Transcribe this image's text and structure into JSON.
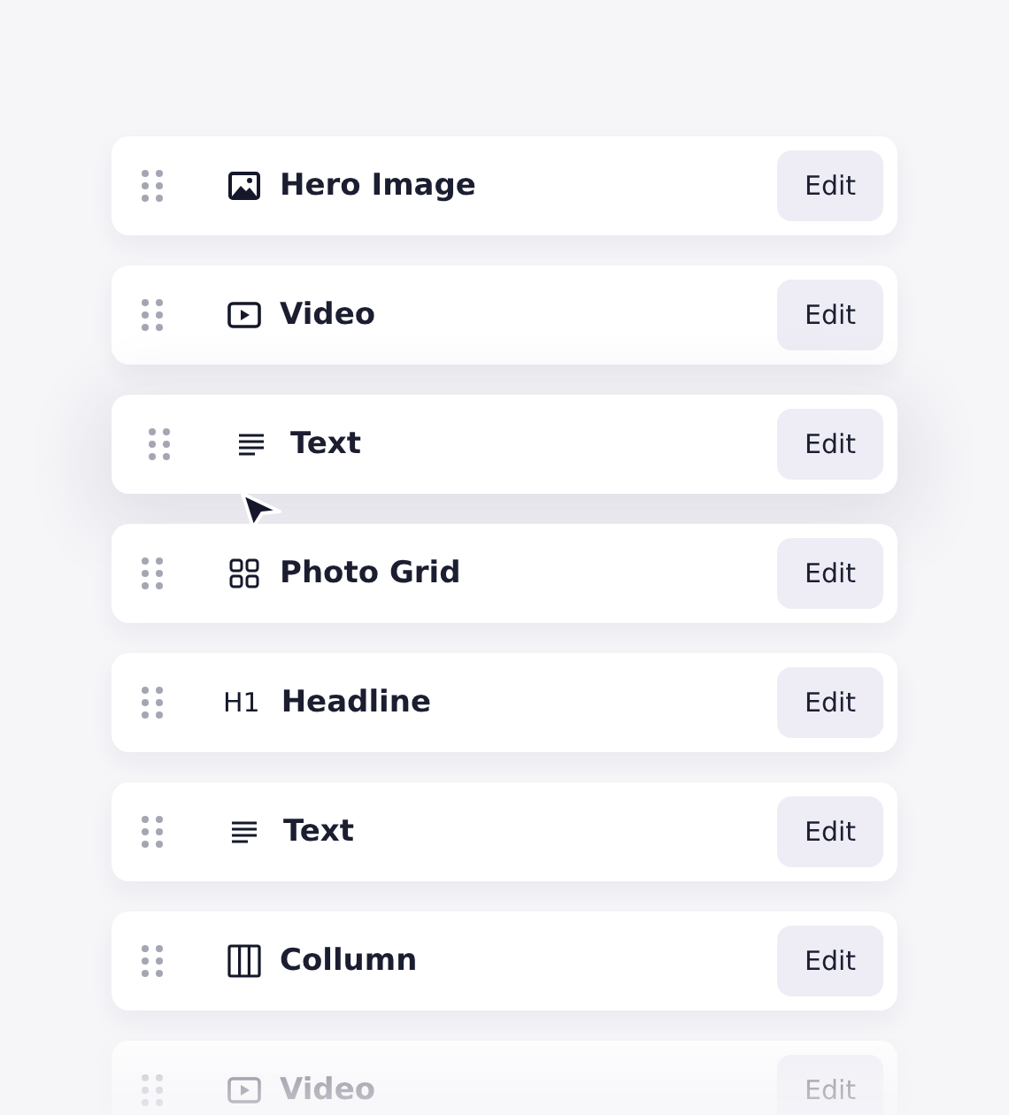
{
  "blocks": [
    {
      "kind": "image",
      "title": "Hero Image",
      "button": "Edit",
      "dragging": false
    },
    {
      "kind": "video",
      "title": "Video",
      "button": "Edit",
      "dragging": false
    },
    {
      "kind": "text",
      "title": "Text",
      "button": "Edit",
      "dragging": true
    },
    {
      "kind": "grid",
      "title": "Photo Grid",
      "button": "Edit",
      "dragging": false
    },
    {
      "kind": "heading",
      "icon_text": "H1",
      "title": "Headline",
      "button": "Edit",
      "dragging": false
    },
    {
      "kind": "text",
      "title": "Text",
      "button": "Edit",
      "dragging": false
    },
    {
      "kind": "columns",
      "title": "Collumn",
      "button": "Edit",
      "dragging": false
    },
    {
      "kind": "video",
      "title": "Video",
      "button": "Edit",
      "dragging": false
    }
  ]
}
